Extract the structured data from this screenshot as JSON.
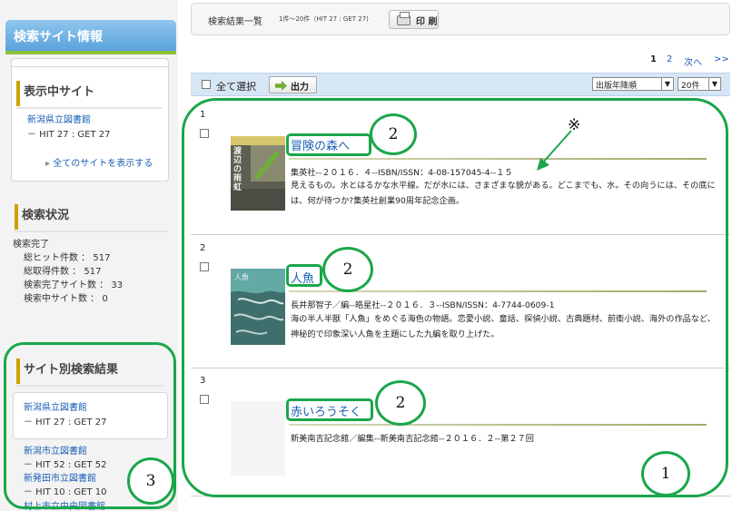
{
  "sidebar": {
    "header": "検索サイト情報",
    "current_sites": {
      "title": "表示中サイト",
      "site": "新潟県立図書館",
      "hit": "－ HIT 27 : GET 27",
      "show_all": "全てのサイトを表示する"
    },
    "status": {
      "title": "検索状況",
      "state": "検索完了",
      "total_hits": "総ヒット件数 ： 517",
      "total_get": "総取得件数 ： 517",
      "done_sites": "検索完了サイト数 ： 33",
      "searching_sites": "検索中サイト数 ： 0"
    },
    "site_results": {
      "title": "サイト別検索結果",
      "items": [
        {
          "name": "新潟県立図書館",
          "hit": "－ HIT 27 : GET 27"
        },
        {
          "name": "新潟市立図書館",
          "hit": "－ HIT 52 : GET 52"
        },
        {
          "name": "新発田市立図書館",
          "hit": "－ HIT 10 : GET 10"
        },
        {
          "name": "村上市立中央図書館"
        }
      ]
    }
  },
  "topbar": {
    "title": "検索結果一覧",
    "count": "1件～20件（HIT 27 : GET 27)",
    "print_label": "印 刷"
  },
  "pager": {
    "current": "1",
    "next_page": "2",
    "next": "次へ",
    "last": ">>"
  },
  "actions": {
    "select_all": "全て選択",
    "output": "出力",
    "sort": "出版年降順",
    "per_page": "20件"
  },
  "results": [
    {
      "num": "1",
      "title": "冒険の森へ",
      "meta": "集英社--２０１６．４--ISBN/ISSN：4-08-157045-4--１５",
      "desc": "見えるもの。水とはるかな水平線。だが水には、さまざまな貌がある。どこまでも、水。その向うには、その底には、何が待つか?集英社創業90周年記念企画。",
      "cover_text": "渡辺の雨虹"
    },
    {
      "num": "2",
      "title": "人魚",
      "meta": "長井那智子／編--皓星社--２０１６．３--ISBN/ISSN：4-7744-0609-1",
      "desc": "海の半人半獣「人魚」をめぐる海色の物語。恋愛小説、童話、探偵小説、古典題材、前衛小説、海外の作品など、神秘的で印象深い人魚を主題にした九編を取り上げた。",
      "cover_text": "人魚"
    },
    {
      "num": "3",
      "title": "赤いろうそく",
      "meta": "新美南吉記念館／編集--新美南吉記念館--２０１６．２--第２７回",
      "desc": ""
    }
  ],
  "annotations": {
    "circle1": "1",
    "circle2": "2",
    "circle3": "3",
    "note_mark": "※"
  },
  "colors": {
    "annotation": "#1aa64a",
    "link": "#1a5fb4",
    "header_blue": "#5aa4dc"
  }
}
